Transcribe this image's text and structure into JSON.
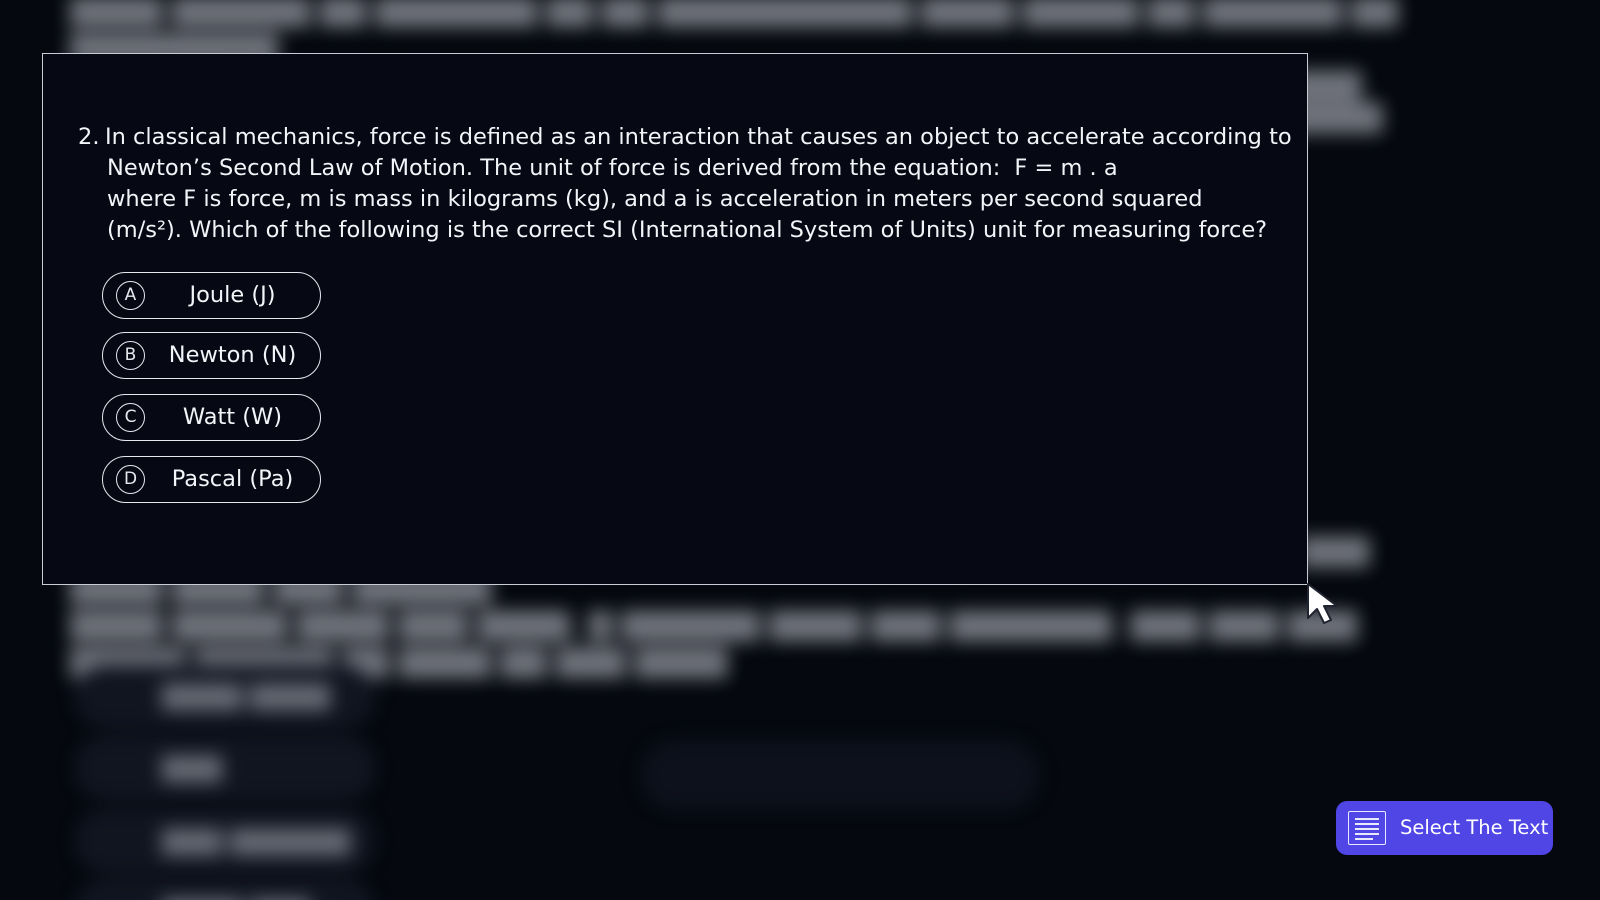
{
  "question": {
    "number": "2.",
    "line1": "In classical mechanics, force is defined as an interaction that causes an object to accelerate according to",
    "line2": "Newton’s Second Law of Motion. The unit of force is derived from the equation:",
    "formula": "F = m . a",
    "line3": "where F is force, m is mass in kilograms (kg), and a is acceleration in meters per second squared",
    "line4": "(m/s²). Which of the following is the correct SI (International System of Units) unit for measuring force?"
  },
  "options": [
    {
      "letter": "A",
      "text": "Joule (J)"
    },
    {
      "letter": "B",
      "text": "Newton (N)"
    },
    {
      "letter": "C",
      "text": "Watt (W)"
    },
    {
      "letter": "D",
      "text": "Pascal (Pa)"
    }
  ],
  "select_button": {
    "label": "Select The Text",
    "icon": "text-lines-icon",
    "color": "#4f46e5"
  },
  "cursor": {
    "icon": "mouse-pointer-icon"
  },
  "colors": {
    "background": "#05080f",
    "panel": "#060914",
    "text": "#f2f4f8"
  }
}
